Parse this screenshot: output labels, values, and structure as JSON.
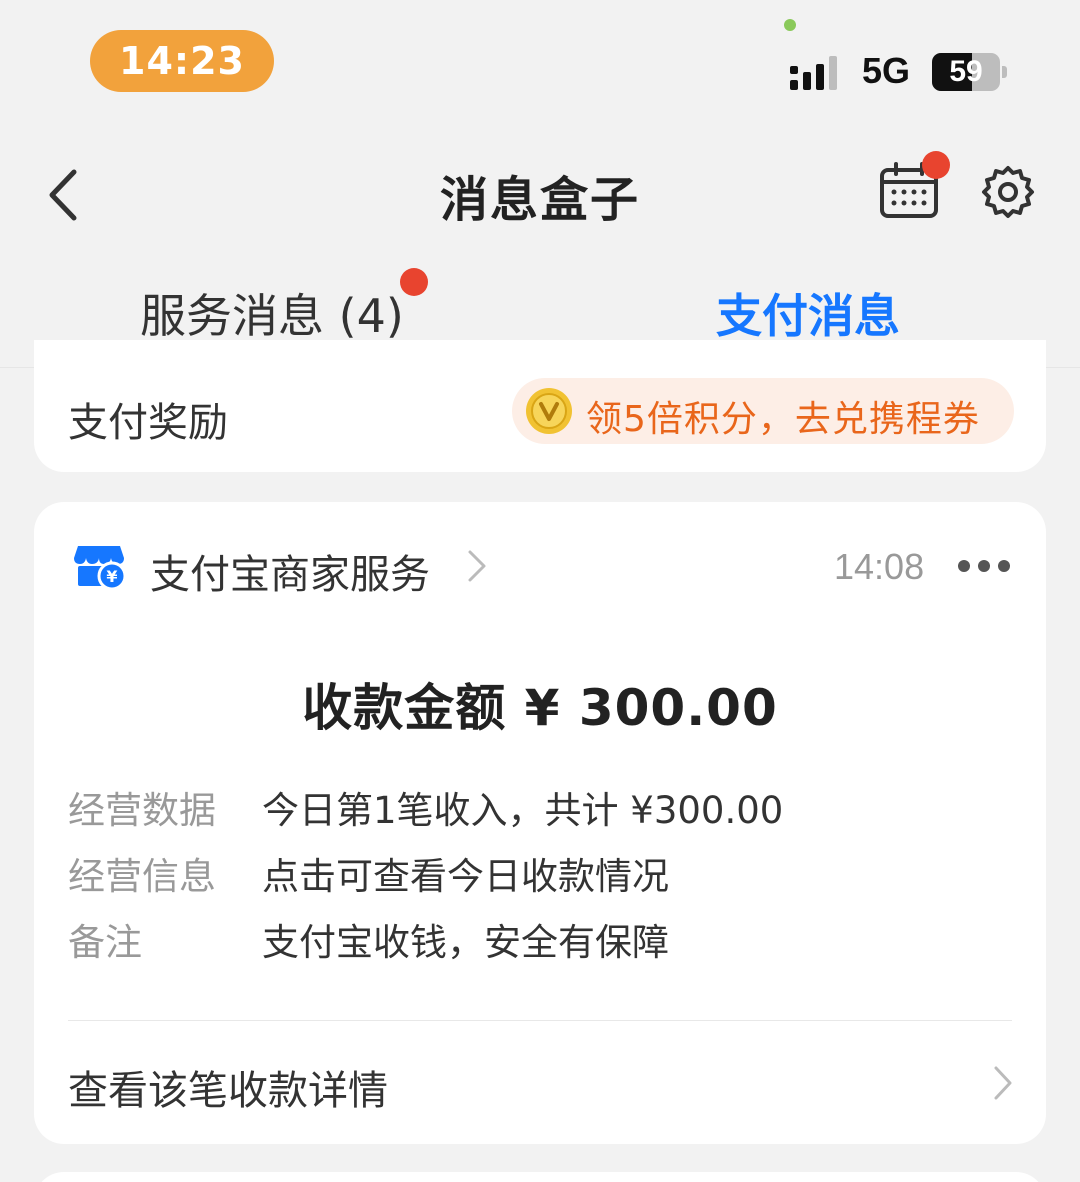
{
  "status_bar": {
    "time": "14:23",
    "network": "5G",
    "battery_level": "59",
    "battery_fraction": 0.59,
    "accent_color": "#f2a23c"
  },
  "nav": {
    "title": "消息盒子",
    "back_icon": "chevron-left-icon",
    "calendar_icon": "calendar-icon",
    "settings_icon": "gear-icon"
  },
  "tabs": [
    {
      "label": "服务消息 (4)",
      "active": false,
      "has_badge": true
    },
    {
      "label": "支付消息",
      "active": true,
      "has_badge": false
    }
  ],
  "reward": {
    "label": "支付奖励",
    "promo_text": "领5倍积分，去兑携程券",
    "promo_color": "#e9661b"
  },
  "message": {
    "sender": "支付宝商家服务",
    "time": "14:08",
    "amount_text": "收款金额 ¥ 300.00",
    "rows": [
      {
        "key": "经营数据",
        "value": "今日第1笔收入，共计 ¥300.00"
      },
      {
        "key": "经营信息",
        "value": "点击可查看今日收款情况"
      },
      {
        "key": "备注",
        "value": "支付宝收钱，安全有保障"
      }
    ],
    "detail_link": "查看该笔收款详情"
  },
  "colors": {
    "brand_blue": "#1677ff",
    "badge_red": "#e8442f",
    "background": "#f2f2f2"
  }
}
